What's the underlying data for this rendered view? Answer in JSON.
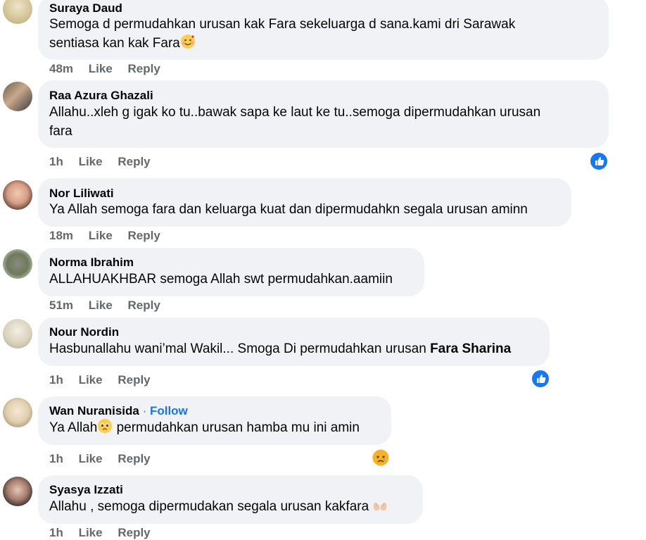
{
  "actions": {
    "like": "Like",
    "reply": "Reply",
    "follow": "Follow"
  },
  "comments": [
    {
      "author": "Suraya Daud",
      "line1": "Semoga d permudahkan urusan kak Fara sekeluarga d sana.kami dri Sarawak",
      "line2": "sentiasa kan kak Fara",
      "emoji": "smiling-face-with-hearts-icon",
      "time": "48m"
    },
    {
      "author": "Raa Azura Ghazali",
      "line1": "Allahu..xleh g igak ko tu..bawak sapa ke laut ke tu..semoga dipermudahkan urusan",
      "line2": "fara",
      "time": "1h",
      "reaction": "like"
    },
    {
      "author": "Nor Liliwati",
      "line1": "Ya Allah semoga fara dan keluarga kuat dan dipermudahkn segala urusan aminn",
      "time": "18m"
    },
    {
      "author": "Norma Ibrahim",
      "line1": "ALLAHUAKHBAR semoga Allah swt permudahkan.aamiin",
      "time": "51m"
    },
    {
      "author": "Nour Nordin",
      "line1": "Hasbunallahu wani’mal Wakil... Smoga Di permudahkan urusan ",
      "mention": "Fara Sharina",
      "time": "1h",
      "reaction": "like"
    },
    {
      "author": "Wan Nuranisida",
      "line1_a": "Ya Allah",
      "line1_b": " permudahkan urusan hamba mu ini amin",
      "emoji": "pleading-face-icon",
      "time": "1h",
      "reaction": "sad"
    },
    {
      "author": "Syasya Izzati",
      "line1": "Allahu , semoga dipermudakan segala urusan kakfara ",
      "emoji": "palms-up-together-icon",
      "time": "1h"
    }
  ],
  "colors": {
    "bubble": "#f0f2f5",
    "meta": "#65676b",
    "accent": "#1877f2",
    "follow": "#1b74e4"
  }
}
